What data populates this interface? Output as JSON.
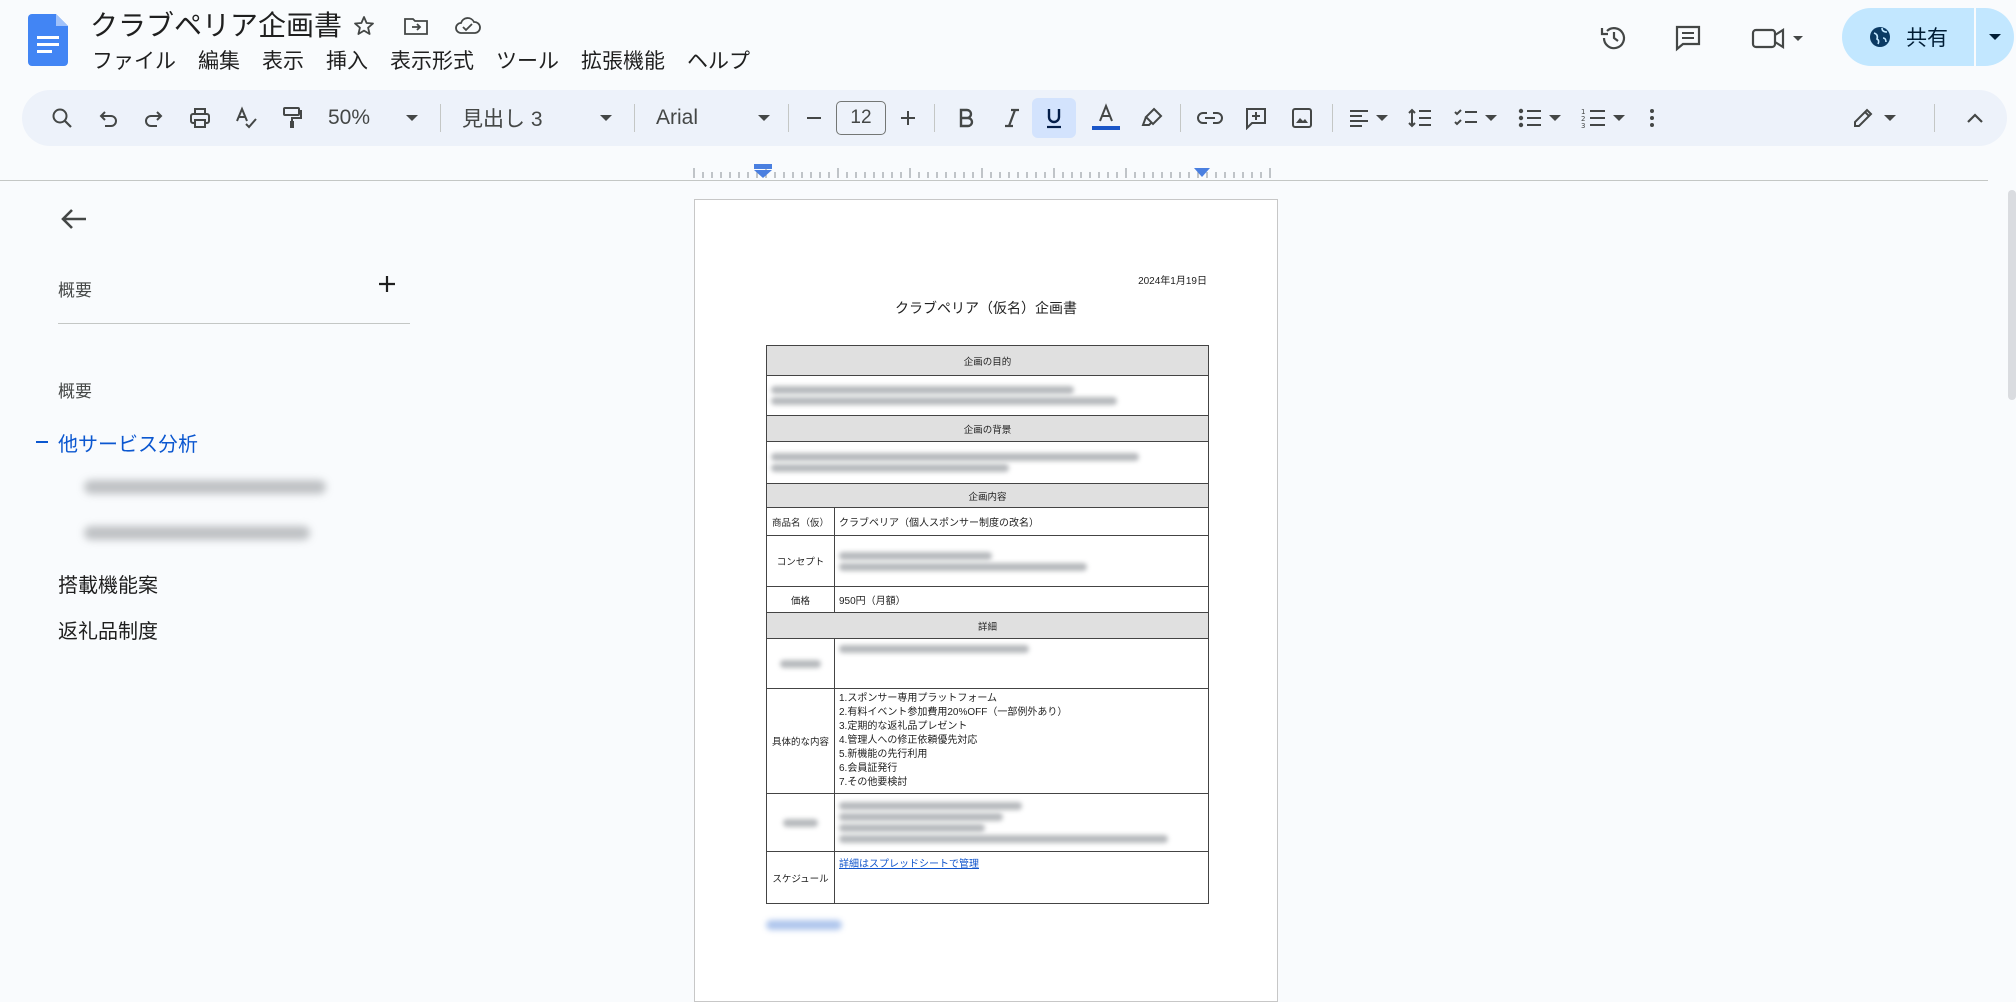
{
  "doc": {
    "title": "クラブペリア企画書"
  },
  "menu": [
    "ファイル",
    "編集",
    "表示",
    "挿入",
    "表示形式",
    "ツール",
    "拡張機能",
    "ヘルプ"
  ],
  "share": {
    "label": "共有"
  },
  "toolbar": {
    "zoom": "50%",
    "style": "見出し 3",
    "font": "Arial",
    "font_size": "12"
  },
  "outline": {
    "summary_header": "概要",
    "section_label": "概要",
    "items": [
      "他サービス分析",
      "搭載機能案",
      "返礼品制度"
    ]
  },
  "page": {
    "date": "2024年1月19日",
    "heading": "クラブペリア（仮名）企画書",
    "sections": {
      "purpose": "企画の目的",
      "background": "企画の背景",
      "content": "企画内容",
      "details": "詳細"
    },
    "rows": {
      "product_label": "商品名（仮）",
      "product_value": "クラブペリア（個人スポンサー制度の改名）",
      "concept_label": "コンセプト",
      "price_label": "価格",
      "price_value": "950円（月額）",
      "specific_label": "具体的な内容",
      "specific_items": [
        "1.スポンサー専用プラットフォーム",
        "2.有料イベント参加費用20%OFF（一部例外あり）",
        "3.定期的な返礼品プレゼント",
        "4.管理人への修正依頼優先対応",
        "5.新機能の先行利用",
        "6.会員証発行",
        "7.その他要検討"
      ],
      "schedule_label": "スケジュール",
      "schedule_link": "詳細はスプレッドシートで管理"
    }
  },
  "colors": {
    "accent": "#0b57d0",
    "share_bg": "#c2e7ff",
    "toolbar_bg": "#edf2fa",
    "doc_icon": "#4285f4"
  }
}
